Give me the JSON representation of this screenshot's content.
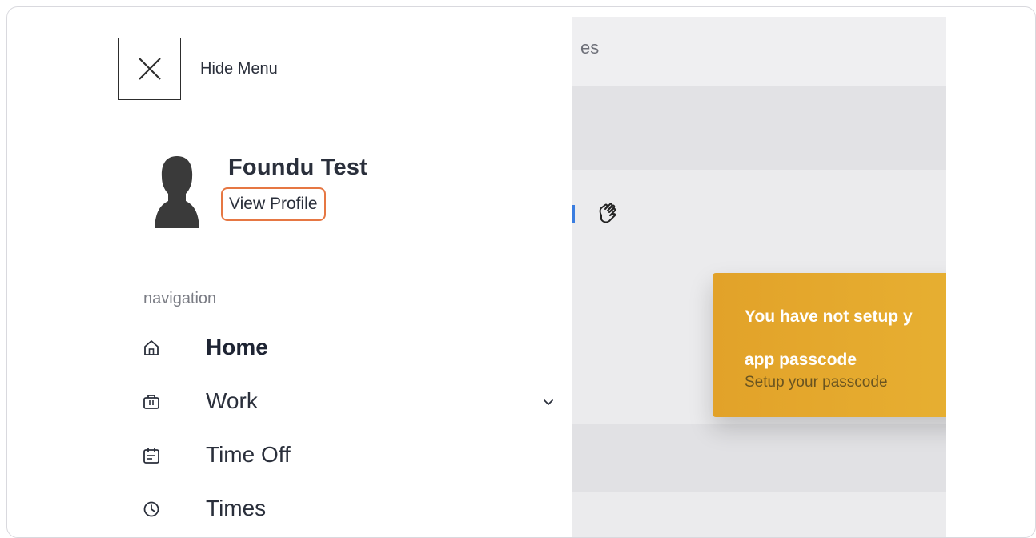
{
  "menu": {
    "hide_label": "Hide Menu",
    "profile": {
      "name": "Foundu Test",
      "view_profile_label": "View Profile"
    },
    "nav_heading": "navigation",
    "items": [
      {
        "label": "Home",
        "icon": "home-icon",
        "active": true
      },
      {
        "label": "Work",
        "icon": "briefcase-icon",
        "has_submenu": true
      },
      {
        "label": "Time Off",
        "icon": "calendar-icon"
      },
      {
        "label": "Times",
        "icon": "clock-icon"
      }
    ]
  },
  "background": {
    "header_text": "es",
    "banner": {
      "title_line1": "You have not setup y",
      "title_line2": "app passcode",
      "subtitle": "Setup your passcode"
    }
  },
  "colors": {
    "highlight": "#e67743",
    "banner": "#e2a229",
    "text": "#2a2f3b",
    "link_blue": "#3a7de0"
  }
}
